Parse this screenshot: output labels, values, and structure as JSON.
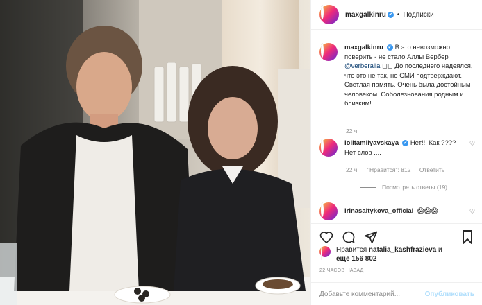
{
  "post": {
    "username": "maxgalkinru",
    "verified_mark": "✔",
    "separator": "•",
    "follow_label": "Подписки"
  },
  "caption": {
    "username": "maxgalkinru",
    "text_part1": "В это невозможно поверить - не стало Аллы Вербер",
    "mention": "@verberalia",
    "text_part2": "◻◻ До последнего надеялся, что это не так, но СМИ подтверждают. Светлая память. Очень была достойным человеком. Соболезнования родным и близким!",
    "time": "22 ч."
  },
  "comments": [
    {
      "username": "lolitamilyavskaya",
      "text": "Нет!!! Как ???? Нет слов ....",
      "time": "22 ч.",
      "likes": "\"Нравится\": 812",
      "reply_label": "Ответить",
      "view_replies": "Посмотреть ответы (19)"
    },
    {
      "username": "irinasaltykova_official",
      "text": "😱😱😱"
    }
  ],
  "likes": {
    "prefix": "Нравится",
    "user": "natalia_kashfrazieva",
    "joiner": "и",
    "others": "ещё 156 802"
  },
  "timestamp": "22 ЧАСОВ НАЗАД",
  "comment_box": {
    "placeholder": "Добавьте комментарий...",
    "publish_label": "Опубликовать"
  },
  "icons": {
    "like": "heart-icon",
    "comment": "comment-icon",
    "share": "share-icon",
    "save": "bookmark-icon"
  },
  "colors": {
    "verified": "#3897f0",
    "mention": "#003569",
    "muted": "#8e8e8e",
    "publish_disabled": "#b2dffc"
  }
}
